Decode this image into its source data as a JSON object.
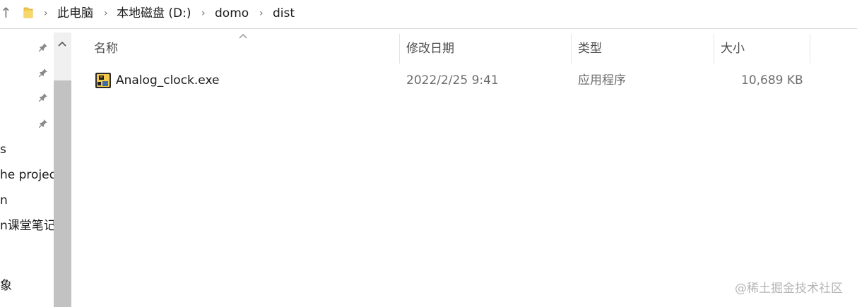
{
  "address_bar": {
    "up_glyph": "↑",
    "breadcrumbs": [
      "此电脑",
      "本地磁盘 (D:)",
      "domo",
      "dist"
    ],
    "separator": "›"
  },
  "nav_pane": {
    "items": [
      "s",
      "he projec",
      "n",
      "n课堂笔记",
      "",
      "象"
    ]
  },
  "columns": {
    "name": "名称",
    "modified": "修改日期",
    "type": "类型",
    "size": "大小"
  },
  "files": [
    {
      "name": "Analog_clock.exe",
      "modified": "2022/2/25 9:41",
      "type": "应用程序",
      "size": "10,689 KB",
      "icon": "python-exe-icon"
    }
  ],
  "watermark": "@稀土掘金技术社区",
  "colors": {
    "folder": "#f2c94c",
    "scrollbar_track": "#f0f0f0",
    "scrollbar_thumb": "#c2c2c2"
  }
}
